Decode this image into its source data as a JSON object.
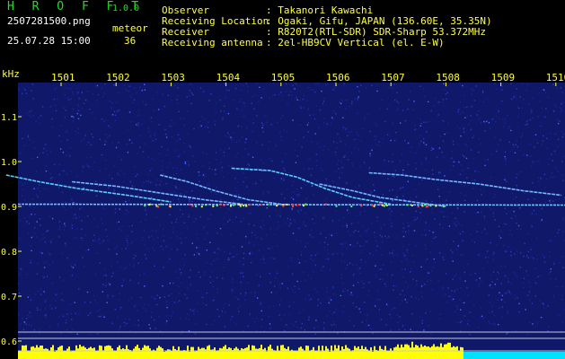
{
  "header": {
    "app_name": "H R O F F T",
    "version": "1.0.0",
    "filename": "2507281500.png",
    "timestamp": "25.07.28 15:00",
    "meteor_label": "meteor",
    "meteor_count": "36",
    "info": [
      {
        "key": "Observer",
        "value": ": Takanori Kawachi"
      },
      {
        "key": "Receiving Location",
        "value": ": Ogaki, Gifu, JAPAN (136.60E, 35.35N)"
      },
      {
        "key": "Receiver",
        "value": ": R820T2(RTL-SDR) SDR-Sharp 53.372MHz"
      },
      {
        "key": "Receiving antenna",
        "value": ": 2el-HB9CV Vertical (el. E-W)"
      }
    ]
  },
  "chart_data": {
    "type": "heatmap",
    "ylabel": "kHz",
    "x_ticks": [
      "1501",
      "1502",
      "1503",
      "1504",
      "1505",
      "1506",
      "1507",
      "1508",
      "1509",
      "1510"
    ],
    "y_ticks": [
      "1.1",
      "1.0",
      "0.9",
      "0.8",
      "0.7",
      "0.6"
    ],
    "ylim": [
      0.6,
      1.15
    ],
    "colors": {
      "background": "#10186a",
      "noise": "#2a3ab8",
      "carrier": "#7fb8ff",
      "hot": "#ff4040",
      "bars": "#ffff00",
      "base": "#00e0ff"
    },
    "meteor_traces": [
      {
        "x": [
          1500.0,
          1500.6,
          1501.3,
          1502.2,
          1503.0
        ],
        "y": [
          0.97,
          0.955,
          0.94,
          0.925,
          0.91
        ]
      },
      {
        "x": [
          1501.2,
          1502.0,
          1502.8,
          1503.6,
          1504.3
        ],
        "y": [
          0.955,
          0.945,
          0.93,
          0.915,
          0.905
        ]
      },
      {
        "x": [
          1502.8,
          1503.3,
          1503.8,
          1504.4,
          1505.0
        ],
        "y": [
          0.97,
          0.955,
          0.935,
          0.915,
          0.905
        ]
      },
      {
        "x": [
          1504.1,
          1504.8,
          1505.3,
          1505.8,
          1506.3,
          1507.0
        ],
        "y": [
          0.985,
          0.98,
          0.965,
          0.94,
          0.92,
          0.905
        ]
      },
      {
        "x": [
          1505.7,
          1506.3,
          1506.8,
          1507.4,
          1508.0
        ],
        "y": [
          0.95,
          0.935,
          0.92,
          0.91,
          0.9
        ]
      },
      {
        "x": [
          1506.6,
          1507.2,
          1507.8,
          1508.6,
          1509.4,
          1510.1
        ],
        "y": [
          0.975,
          0.97,
          0.96,
          0.95,
          0.935,
          0.925
        ]
      }
    ]
  }
}
